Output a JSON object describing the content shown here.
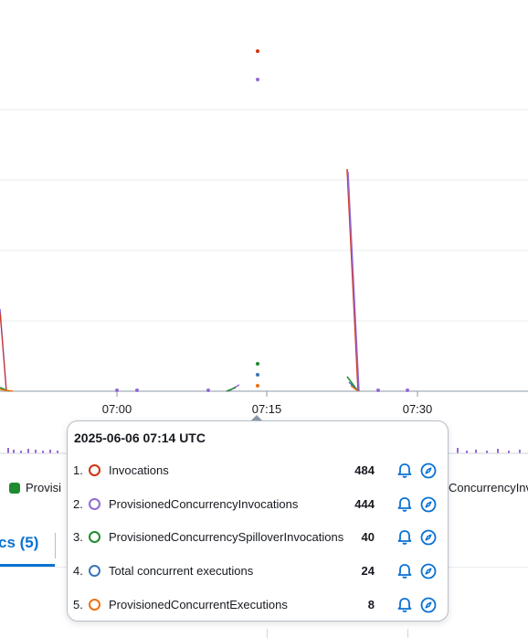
{
  "chart_data": {
    "type": "line",
    "x_ticks": [
      "07:00",
      "07:15",
      "07:30"
    ],
    "series_colors": {
      "invocations": "#d13212",
      "provisioned_invocations": "#9469d6",
      "spillover": "#2ea597",
      "total_concurrent": "#3b76b9",
      "provisioned_executions": "#ec7211",
      "green_line": "#1f8b2f"
    }
  },
  "legend": {
    "left_partial": "Provisi",
    "right_partial": "ConcurrencyInv",
    "left_color": "#1f8b2f"
  },
  "tabs": {
    "metrics_label": "cs (5)"
  },
  "tooltip": {
    "title": "2025-06-06 07:14 UTC",
    "rows": [
      {
        "num": "1.",
        "label": "Invocations",
        "value": "484",
        "color": "#d13212",
        "icon_bell": "bell-icon",
        "icon_compass": "compass-icon"
      },
      {
        "num": "2.",
        "label": "ProvisionedConcurrencyInvocations",
        "value": "444",
        "color": "#9469d6",
        "icon_bell": "bell-icon",
        "icon_compass": "compass-icon"
      },
      {
        "num": "3.",
        "label": "ProvisionedConcurrencySpilloverInvocations",
        "value": "40",
        "color": "#1f8b2f",
        "icon_bell": "bell-icon",
        "icon_compass": "compass-icon"
      },
      {
        "num": "4.",
        "label": "Total concurrent executions",
        "value": "24",
        "color": "#3b76b9",
        "icon_bell": "bell-icon",
        "icon_compass": "compass-icon"
      },
      {
        "num": "5.",
        "label": "ProvisionedConcurrentExecutions",
        "value": "8",
        "color": "#ec7211",
        "icon_bell": "bell-icon",
        "icon_compass": "compass-icon"
      }
    ]
  }
}
